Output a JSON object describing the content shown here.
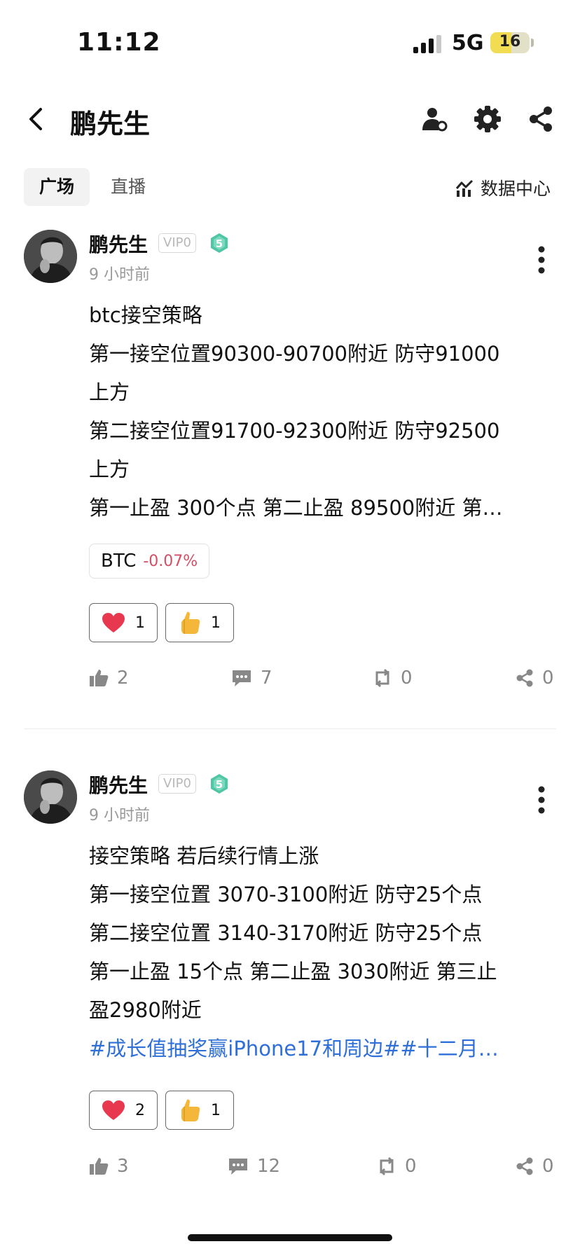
{
  "status_bar": {
    "time": "11:12",
    "network": "5G",
    "battery": "16"
  },
  "header": {
    "title": "鹏先生",
    "icons": [
      "person-settings-icon",
      "gear-icon",
      "share-icon"
    ]
  },
  "tabs": [
    {
      "label": "广场",
      "active": true
    },
    {
      "label": "直播",
      "active": false
    }
  ],
  "data_center": {
    "label": "数据中心",
    "icon": "chart-icon"
  },
  "posts": [
    {
      "author": "鹏先生",
      "vip": "VIP0",
      "level": "5",
      "time": "9 小时前",
      "lines": [
        "btc接空策略",
        "第一接空位置90300-90700附近 防守91000",
        "上方",
        "第二接空位置91700-92300附近 防守92500",
        "上方",
        "第一止盈 300个点 第二止盈 89500附近 第…"
      ],
      "ticker": {
        "symbol": "BTC",
        "change": "-0.07%"
      },
      "reactions": [
        {
          "icon": "heart-icon",
          "count": "1"
        },
        {
          "icon": "thumbs-up-icon",
          "count": "1"
        }
      ],
      "stats": {
        "likes": "2",
        "comments": "7",
        "reposts": "0",
        "shares": "0"
      }
    },
    {
      "author": "鹏先生",
      "vip": "VIP0",
      "level": "5",
      "time": "9 小时前",
      "lines": [
        "接空策略 若后续行情上涨",
        "第一接空位置 3070-3100附近  防守25个点",
        "第二接空位置 3140-3170附近 防守25个点",
        "第一止盈 15个点 第二止盈 3030附近 第三止",
        "盈2980附近"
      ],
      "hashtags": "#成长值抽奖赢iPhone17和周边##十二月…",
      "reactions": [
        {
          "icon": "heart-icon",
          "count": "2"
        },
        {
          "icon": "thumbs-up-icon",
          "count": "1"
        }
      ],
      "stats": {
        "likes": "3",
        "comments": "12",
        "reposts": "0",
        "shares": "0"
      }
    }
  ]
}
